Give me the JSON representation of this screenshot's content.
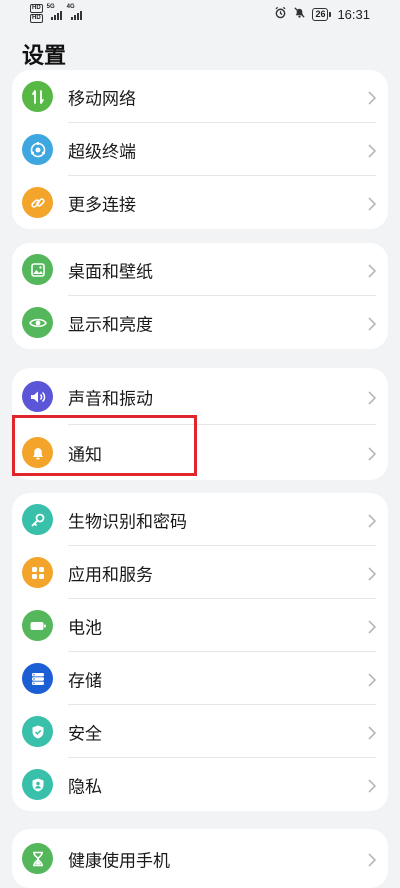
{
  "status_bar": {
    "hd_top": "HD",
    "hd_bottom": "HD",
    "net_1": "5G",
    "net_2": "4G",
    "battery": "26",
    "time": "16:31"
  },
  "page": {
    "title": "设置"
  },
  "groups": [
    {
      "items": [
        {
          "label": "移动网络",
          "icon": "mobile-data-icon",
          "color": "#57b846"
        },
        {
          "label": "超级终端",
          "icon": "super-device-icon",
          "color": "#3ea7e0"
        },
        {
          "label": "更多连接",
          "icon": "link-icon",
          "color": "#f3a42b"
        }
      ]
    },
    {
      "items": [
        {
          "label": "桌面和壁纸",
          "icon": "wallpaper-icon",
          "color": "#55b75b"
        },
        {
          "label": "显示和亮度",
          "icon": "eye-icon",
          "color": "#55b75b"
        }
      ]
    },
    {
      "items": [
        {
          "label": "声音和振动",
          "icon": "speaker-icon",
          "color": "#5b56d8"
        },
        {
          "label": "通知",
          "icon": "bell-icon",
          "color": "#f3a42b"
        }
      ]
    },
    {
      "items": [
        {
          "label": "生物识别和密码",
          "icon": "key-icon",
          "color": "#39c0aa"
        },
        {
          "label": "应用和服务",
          "icon": "apps-icon",
          "color": "#f3a42b"
        },
        {
          "label": "电池",
          "icon": "battery-icon",
          "color": "#55b75b"
        },
        {
          "label": "存储",
          "icon": "storage-icon",
          "color": "#1c5fd4"
        },
        {
          "label": "安全",
          "icon": "security-shield-icon",
          "color": "#39c0aa"
        },
        {
          "label": "隐私",
          "icon": "privacy-icon",
          "color": "#39c0aa"
        }
      ]
    },
    {
      "items": [
        {
          "label": "健康使用手机",
          "icon": "hourglass-icon",
          "color": "#55b75b"
        }
      ]
    }
  ],
  "colors": {
    "background": "#f1f3f5",
    "highlight": "#e0252b"
  }
}
